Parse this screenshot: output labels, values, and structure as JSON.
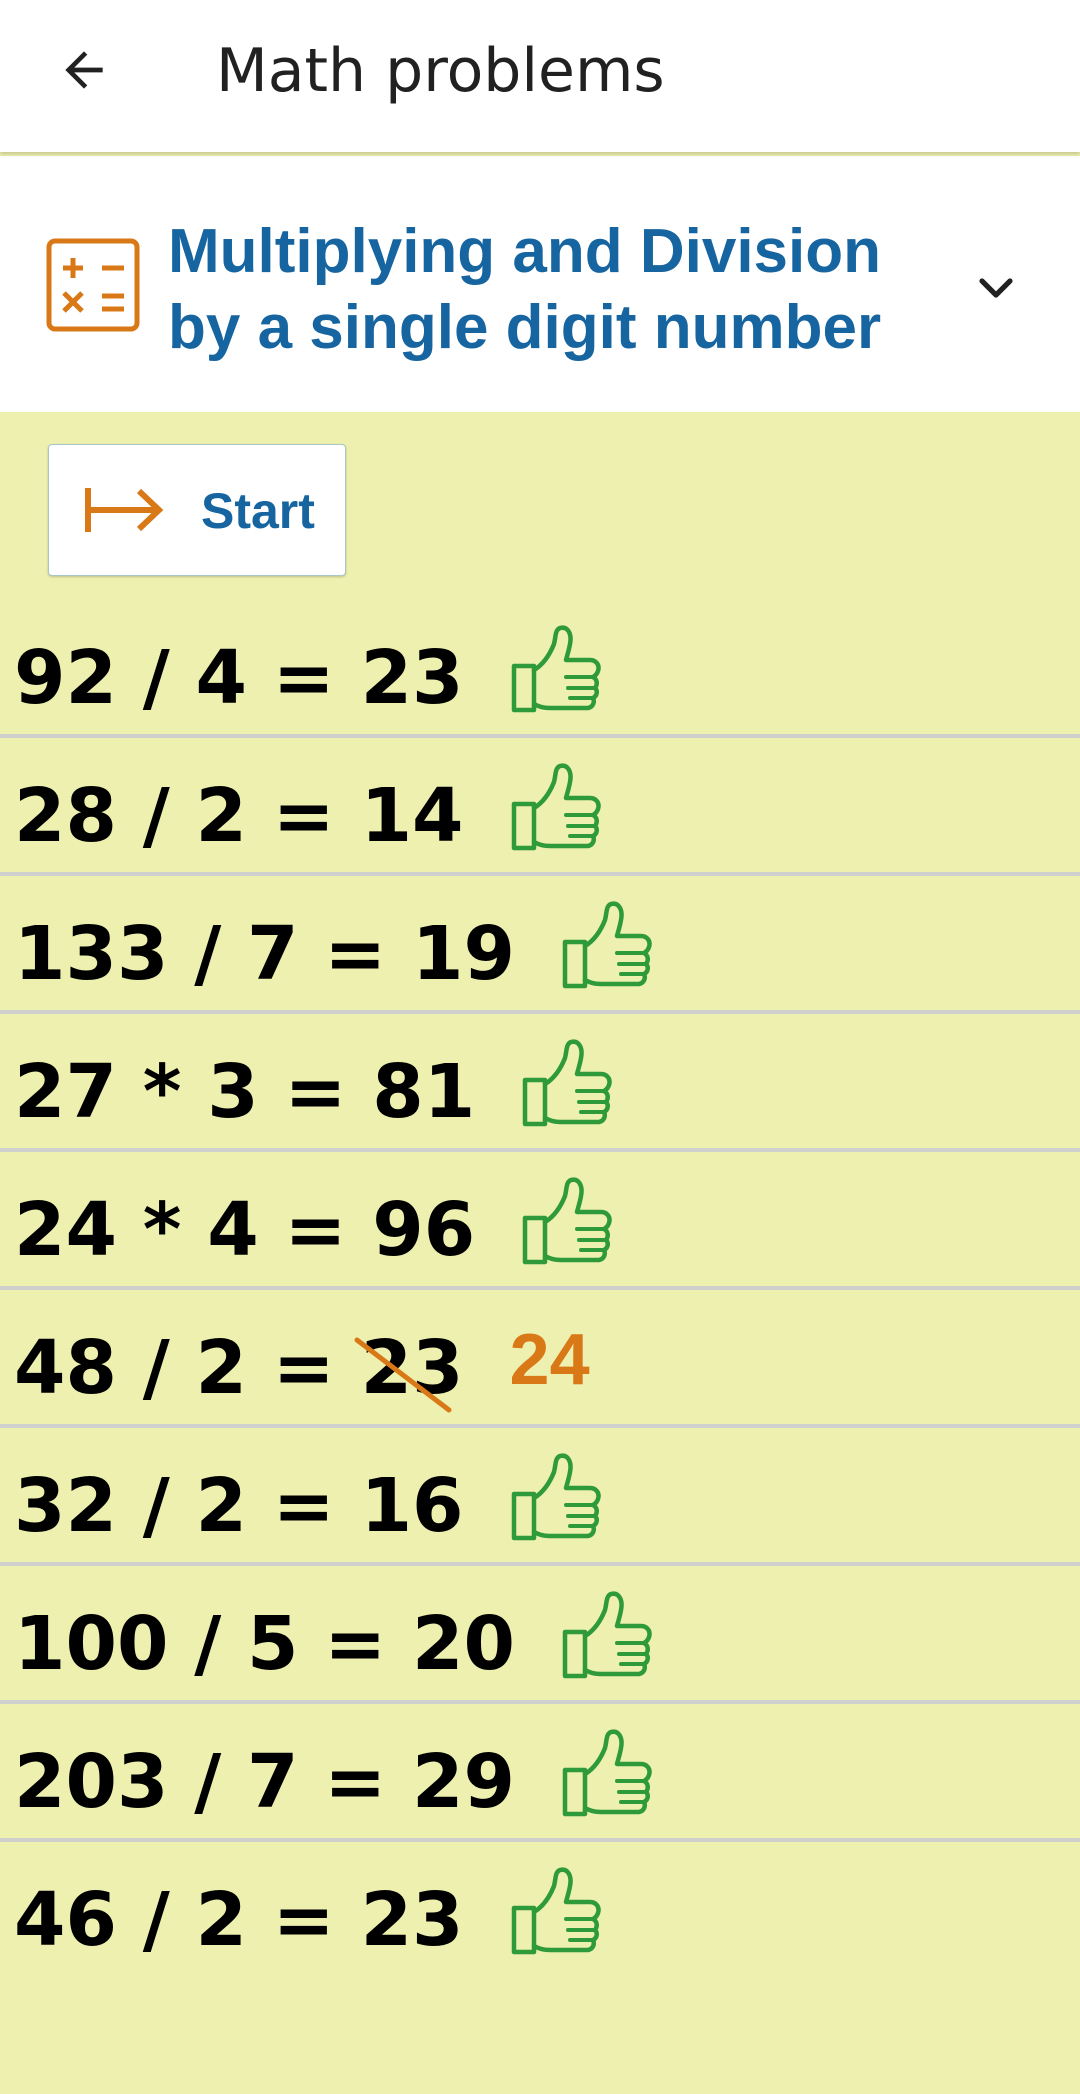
{
  "appbar": {
    "title": "Math problems",
    "back_icon": "arrow-left-icon"
  },
  "topic": {
    "title": "Multiplying and Division by a single digit number",
    "icon": "calculator-icon",
    "accent_color": "#1765a0",
    "icon_color": "#d97817",
    "expand_icon": "chevron-down-icon"
  },
  "start_button": {
    "label": "Start",
    "icon": "start-arrow-icon"
  },
  "colors": {
    "background": "#edf0ae",
    "correct": "#2e9a3a",
    "wrong": "#d97817"
  },
  "problems": [
    {
      "expression": "92 / 4 = ",
      "answer": "23",
      "correct": true,
      "correction": ""
    },
    {
      "expression": "28 / 2 = ",
      "answer": "14",
      "correct": true,
      "correction": ""
    },
    {
      "expression": "133 / 7 = ",
      "answer": "19",
      "correct": true,
      "correction": ""
    },
    {
      "expression": "27 * 3 = ",
      "answer": "81",
      "correct": true,
      "correction": ""
    },
    {
      "expression": "24 * 4 = ",
      "answer": "96",
      "correct": true,
      "correction": ""
    },
    {
      "expression": "48 / 2 = ",
      "answer": "23",
      "correct": false,
      "correction": "24"
    },
    {
      "expression": "32 / 2 = ",
      "answer": "16",
      "correct": true,
      "correction": ""
    },
    {
      "expression": "100 / 5 = ",
      "answer": "20",
      "correct": true,
      "correction": ""
    },
    {
      "expression": "203 / 7 = ",
      "answer": "29",
      "correct": true,
      "correction": ""
    },
    {
      "expression": "46 / 2 = ",
      "answer": "23",
      "correct": true,
      "correction": ""
    }
  ]
}
